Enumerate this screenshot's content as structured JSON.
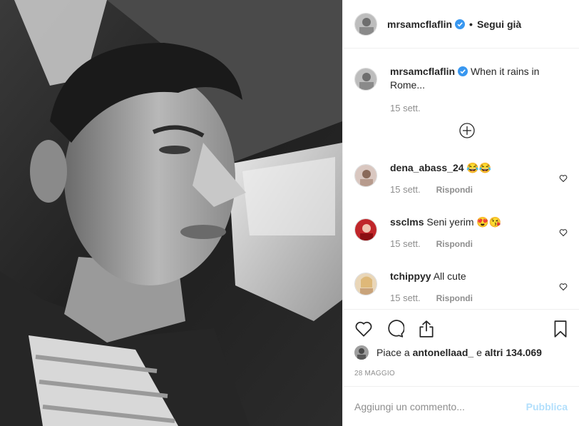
{
  "header": {
    "username": "mrsamcflaflin",
    "separator": "•",
    "follow_label": "Segui già"
  },
  "caption": {
    "username": "mrsamcflaflin",
    "text": "When it rains in Rome...",
    "time": "15 sett."
  },
  "comments": [
    {
      "username": "dena_abass_24",
      "text": "😂😂",
      "time": "15 sett.",
      "reply_label": "Rispondi"
    },
    {
      "username": "ssclms",
      "text": "Seni yerim 😍😘",
      "time": "15 sett.",
      "reply_label": "Rispondi"
    },
    {
      "username": "tchippyy",
      "text": "All cute",
      "time": "15 sett.",
      "reply_label": "Rispondi"
    }
  ],
  "likes": {
    "prefix": "Piace a",
    "user": "antonellaad_",
    "middle": "e",
    "others": "altri 134.069"
  },
  "date": "28 MAGGIO",
  "add_comment": {
    "placeholder": "Aggiungi un commento...",
    "publish_label": "Pubblica"
  },
  "colors": {
    "verified": "#3897f0",
    "publish_disabled": "#b2dffc",
    "secondary_text": "#8e8e8e"
  },
  "icons": [
    "verified-badge-icon",
    "plus-circle-icon",
    "heart-icon",
    "comment-icon",
    "share-icon",
    "bookmark-icon"
  ]
}
